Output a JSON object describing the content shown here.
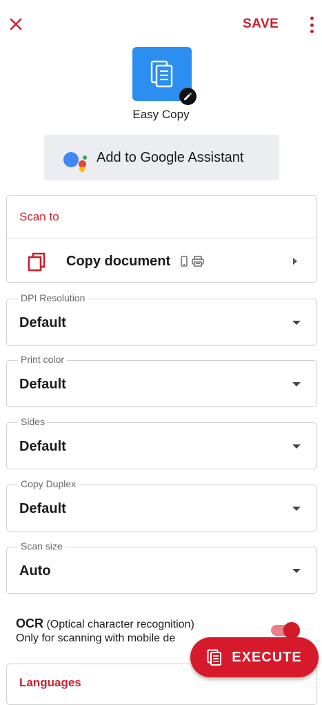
{
  "topbar": {
    "close_icon": "close-icon",
    "save_label": "SAVE",
    "more_icon": "more-vert-icon",
    "accent_color": "#cc1f2f"
  },
  "app": {
    "name": "Easy Copy",
    "tile_icon": "document-copy-icon",
    "edit_icon": "pencil-icon",
    "tile_color": "#2b8ef0"
  },
  "assistant": {
    "label": "Add to Google Assistant",
    "icon": "google-assistant-icon"
  },
  "scan_to": {
    "title": "Scan to",
    "destination_label": "Copy document",
    "destination_icon": "copy-document-icon",
    "device_icons": [
      "phone-icon",
      "printer-icon"
    ],
    "expand_icon": "play-arrow-icon"
  },
  "fields": [
    {
      "label": "DPI Resolution",
      "value": "Default"
    },
    {
      "label": "Print color",
      "value": "Default"
    },
    {
      "label": "Sides",
      "value": "Default"
    },
    {
      "label": "Copy Duplex",
      "value": "Default"
    },
    {
      "label": "Scan size",
      "value": "Auto"
    }
  ],
  "ocr": {
    "title": "OCR",
    "subtitle": "(Optical character recognition)",
    "note": "Only for scanning with mobile de",
    "enabled": true
  },
  "languages": {
    "title": "Languages"
  },
  "execute": {
    "label": "EXECUTE",
    "icon": "document-copy-icon",
    "color": "#d71a2b"
  }
}
